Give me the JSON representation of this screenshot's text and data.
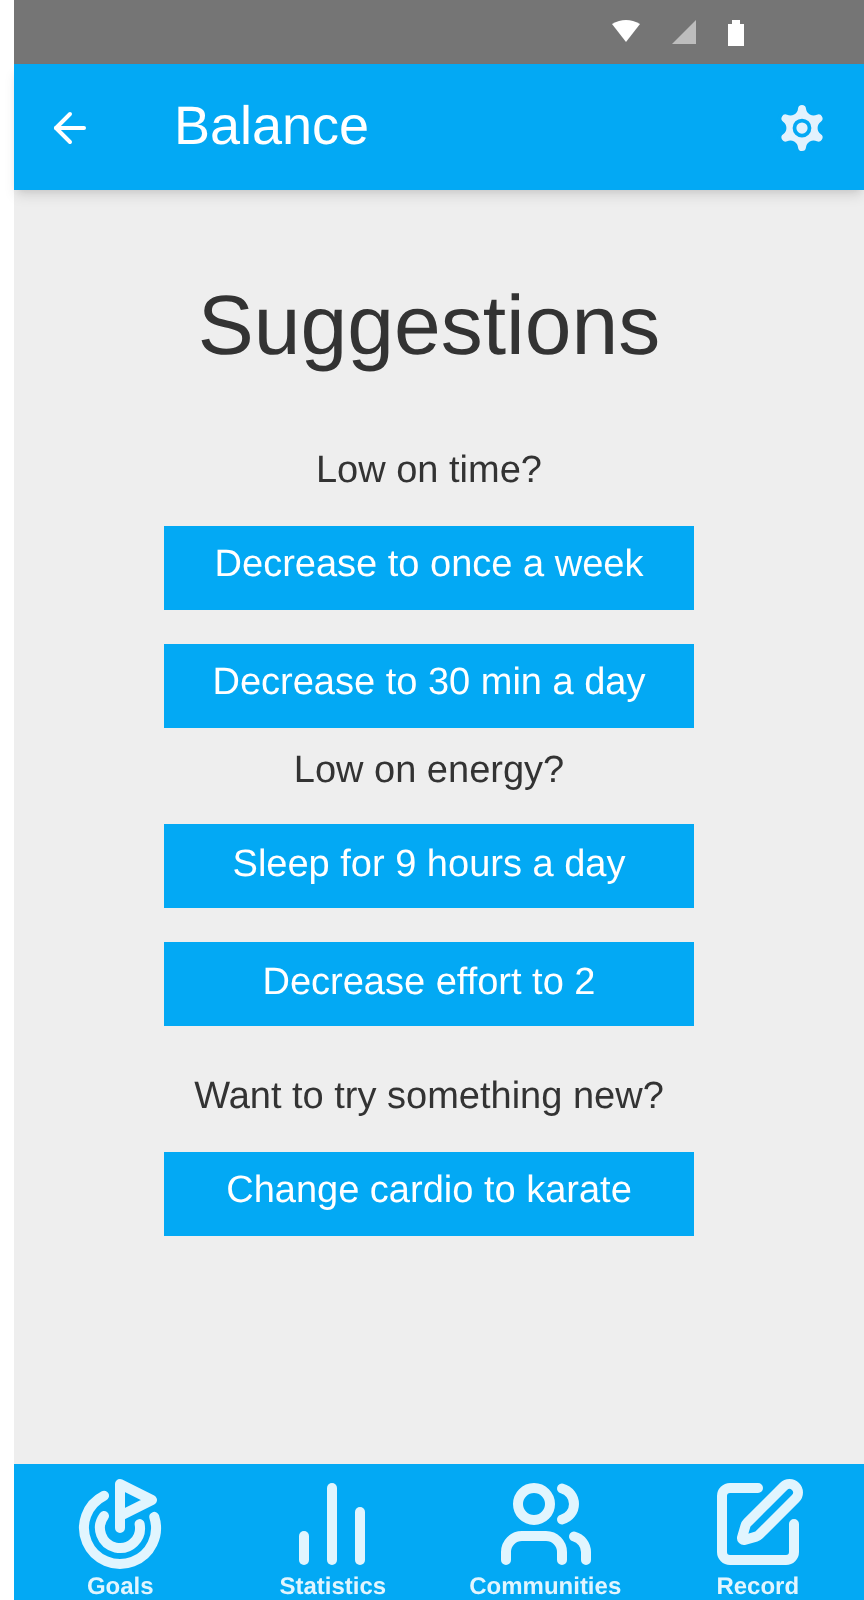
{
  "app_bar": {
    "title": "Balance"
  },
  "heading": "Suggestions",
  "items": [
    {
      "kind": "label",
      "text": "Low on time?"
    },
    {
      "kind": "button",
      "text": "Decrease to once a week"
    },
    {
      "kind": "button",
      "text": "Decrease to 30 min a day"
    },
    {
      "kind": "label",
      "text": "Low on energy?"
    },
    {
      "kind": "button",
      "text": "Sleep for 9 hours a day"
    },
    {
      "kind": "button",
      "text": "Decrease effort to 2"
    },
    {
      "kind": "label",
      "text": "Want to try something new?"
    },
    {
      "kind": "button",
      "text": "Change cardio to karate"
    }
  ],
  "bottom_nav": [
    {
      "kind": "goals",
      "label": "Goals"
    },
    {
      "kind": "statistics",
      "label": "Statistics"
    },
    {
      "kind": "communities",
      "label": "Communities"
    },
    {
      "kind": "record",
      "label": "Record"
    }
  ]
}
